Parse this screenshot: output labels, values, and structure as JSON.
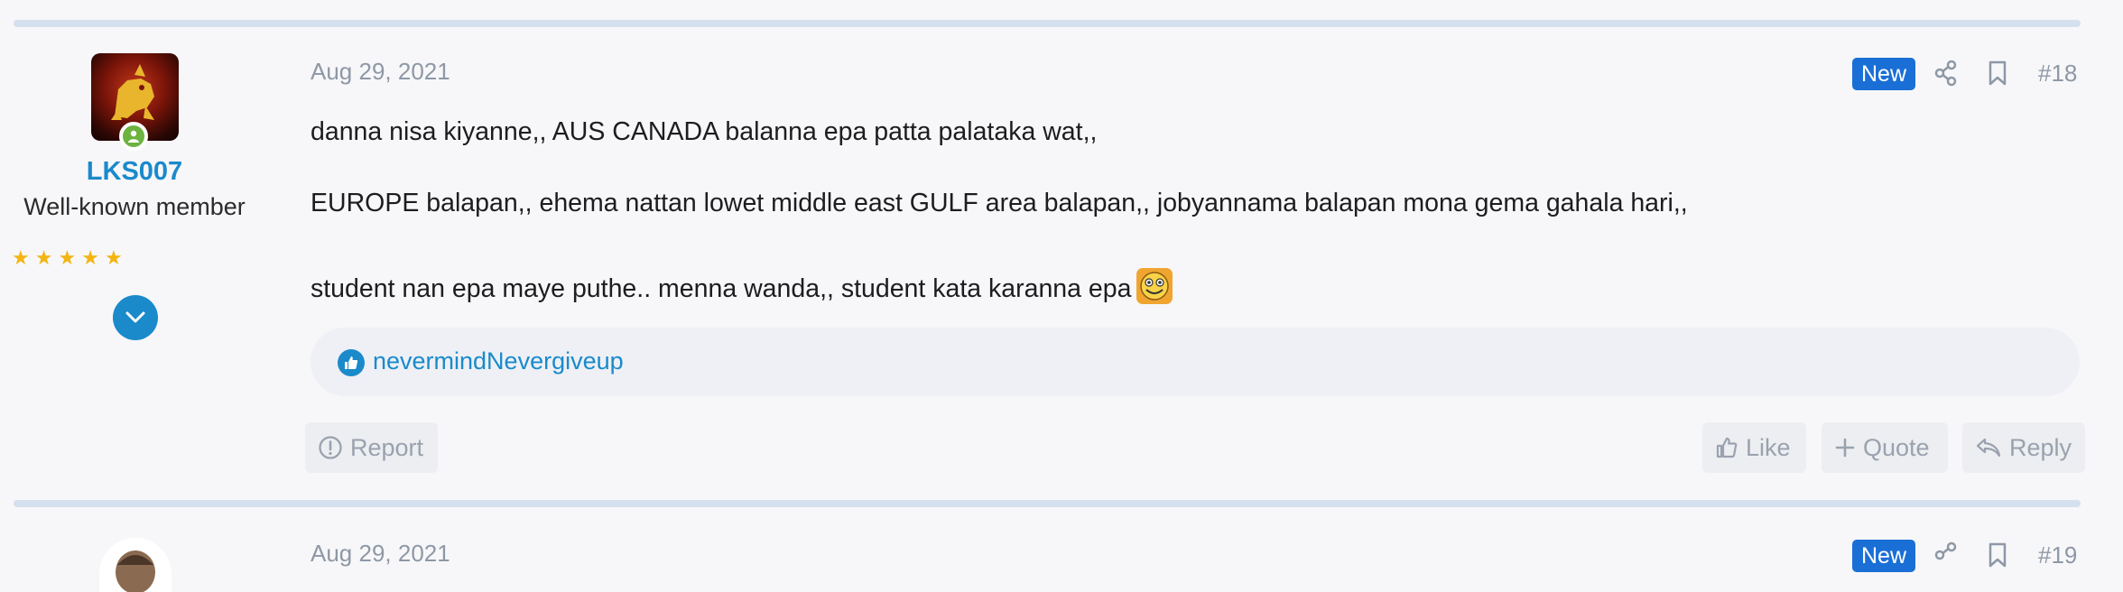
{
  "post": {
    "date": "Aug 29, 2021",
    "badge": "New",
    "number": "#18",
    "lines": [
      "danna nisa kiyanne,, AUS CANADA balanna epa patta palataka wat,,",
      "EUROPE balapan,, ehema nattan lowet middle east GULF area balapan,, jobyannama balapan mona gema gahala hari,,",
      "student nan epa maye puthe.. menna wanda,, student kata karanna epa"
    ],
    "reaction_user": "nevermindNevergiveup"
  },
  "user": {
    "name": "LKS007",
    "title": "Well-known member",
    "stars": 5
  },
  "actions": {
    "report": "Report",
    "like": "Like",
    "quote": "Quote",
    "reply": "Reply"
  },
  "next_post": {
    "date": "Aug 29, 2021",
    "badge": "New",
    "number": "#19"
  },
  "colors": {
    "accent": "#1a8acb",
    "badge": "#1a6fd6",
    "separator": "#d5e0ef",
    "online": "#6cb33f",
    "star": "#f3b512"
  },
  "icons": [
    "share-icon",
    "bookmark-icon",
    "report-icon",
    "like-icon",
    "quote-plus-icon",
    "reply-icon",
    "chevron-down-icon",
    "thumbs-up-icon",
    "smiley-emoji"
  ]
}
